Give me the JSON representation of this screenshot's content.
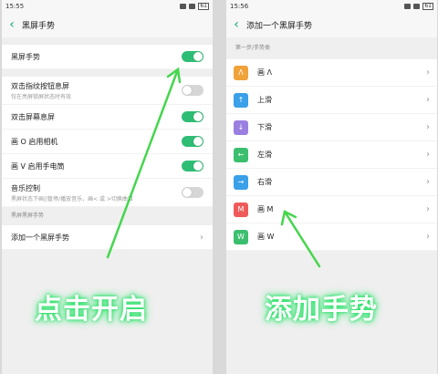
{
  "left": {
    "status": {
      "time": "15:55",
      "battery": "61"
    },
    "header": {
      "title": "黑屏手势"
    },
    "toggles": [
      {
        "label": "黑屏手势",
        "on": true
      },
      {
        "label": "双击指纹按钮息屏",
        "sub": "仅在亮屏锁屏状态时有效",
        "on": false
      },
      {
        "label": "双击屏幕息屏",
        "on": true
      },
      {
        "label": "画 O 启用相机",
        "on": true
      },
      {
        "label": "画 V 启用手电筒",
        "on": true
      },
      {
        "label": "音乐控制",
        "sub": "黑屏状态下画||暂停/播放音乐，画< 或 >切换曲目",
        "on": false
      }
    ],
    "group_label": "黑屏黑屏手势",
    "add_item": "添加一个黑屏手势",
    "overlay": "点击开启"
  },
  "right": {
    "status": {
      "time": "15:56",
      "battery": "61"
    },
    "header": {
      "title": "添加一个黑屏手势"
    },
    "group_label": "第一步/手势类",
    "gestures": [
      {
        "icon": "Λ",
        "label": "画 Λ",
        "color": "#f0a23b"
      },
      {
        "icon": "↑",
        "label": "上滑",
        "color": "#3aa0e8"
      },
      {
        "icon": "↓",
        "label": "下滑",
        "color": "#9b7fe0"
      },
      {
        "icon": "←",
        "label": "左滑",
        "color": "#3bbf6e"
      },
      {
        "icon": "→",
        "label": "右滑",
        "color": "#3aa0e8"
      },
      {
        "icon": "M",
        "label": "画 M",
        "color": "#ee5a5a"
      },
      {
        "icon": "W",
        "label": "画 W",
        "color": "#3bbf6e"
      }
    ],
    "overlay": "添加手势"
  }
}
